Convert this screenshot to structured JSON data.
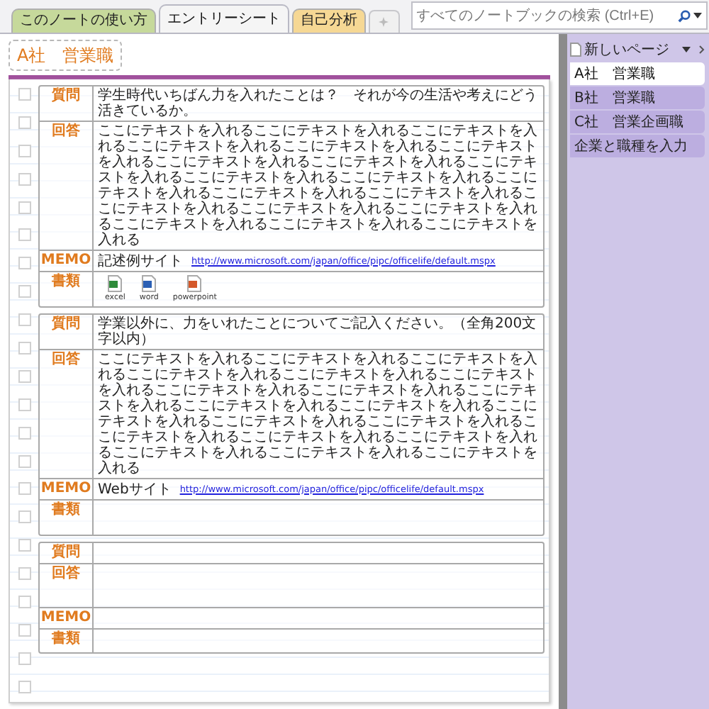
{
  "tabs": [
    {
      "label": "このノートの使い方",
      "selected": false,
      "color": "#c6d99b"
    },
    {
      "label": "エントリーシート",
      "selected": true,
      "color": "#f5f5f5"
    },
    {
      "label": "自己分析",
      "selected": false,
      "color": "#f6d894"
    }
  ],
  "search": {
    "placeholder": "すべてのノートブックの検索 (Ctrl+E)"
  },
  "page": {
    "title": "A社　営業職",
    "sections": [
      {
        "rows": [
          {
            "kind": "text",
            "label": "質問",
            "text": "学生時代いちばん力を入れたことは？　それが今の生活や考えにどう活きているか。"
          },
          {
            "kind": "text",
            "label": "回答",
            "text": "ここにテキストを入れるここにテキストを入れるここにテキストを入れるここにテキストを入れるここにテキストを入れるここにテキストを入れるここにテキストを入れるここにテキストを入れるここにテキストを入れるここにテキストを入れるここにテキストを入れるここにテキストを入れるここにテキストを入れるここにテキストを入れるここにテキストを入れるここにテキストを入れるここにテキストを入れるここにテキストを入れるここにテキストを入れるここにテキストを入れる"
          },
          {
            "kind": "link",
            "label": "MEMO",
            "text": "記述例サイト",
            "link": "http://www.microsoft.com/japan/office/pipc/officelife/default.mspx"
          },
          {
            "kind": "files",
            "label": "書類",
            "files": [
              {
                "name": "excel",
                "color": "#2e8b3a"
              },
              {
                "name": "word",
                "color": "#2b5fb4"
              },
              {
                "name": "powerpoint",
                "color": "#d4582a"
              }
            ]
          }
        ]
      },
      {
        "rows": [
          {
            "kind": "text",
            "label": "質問",
            "text": "学業以外に、力をいれたことについてご記入ください。（全角200文字以内）"
          },
          {
            "kind": "text",
            "label": "回答",
            "text": "ここにテキストを入れるここにテキストを入れるここにテキストを入れるここにテキストを入れるここにテキストを入れるここにテキストを入れるここにテキストを入れるここにテキストを入れるここにテキストを入れるここにテキストを入れるここにテキストを入れるここにテキストを入れるここにテキストを入れるここにテキストを入れるここにテキストを入れるここにテキストを入れるここにテキストを入れるここにテキストを入れるここにテキストを入れるここにテキストを入れる"
          },
          {
            "kind": "link",
            "label": "MEMO",
            "text": "Webサイト",
            "link": "http://www.microsoft.com/japan/office/pipc/officelife/default.mspx"
          },
          {
            "kind": "files",
            "label": "書類",
            "files": []
          }
        ]
      },
      {
        "rows": [
          {
            "kind": "blank",
            "label": "質問"
          },
          {
            "kind": "blank",
            "label": "回答"
          },
          {
            "kind": "blank",
            "label": "MEMO"
          },
          {
            "kind": "blank",
            "label": "書類"
          }
        ]
      }
    ]
  },
  "sidebar": {
    "new_page": "新しいページ",
    "pages": [
      {
        "label": "A社　営業職",
        "selected": true
      },
      {
        "label": "B社　営業職",
        "selected": false
      },
      {
        "label": "C社　営業企画職",
        "selected": false
      },
      {
        "label": "企業と職種を入力",
        "selected": false
      }
    ]
  }
}
